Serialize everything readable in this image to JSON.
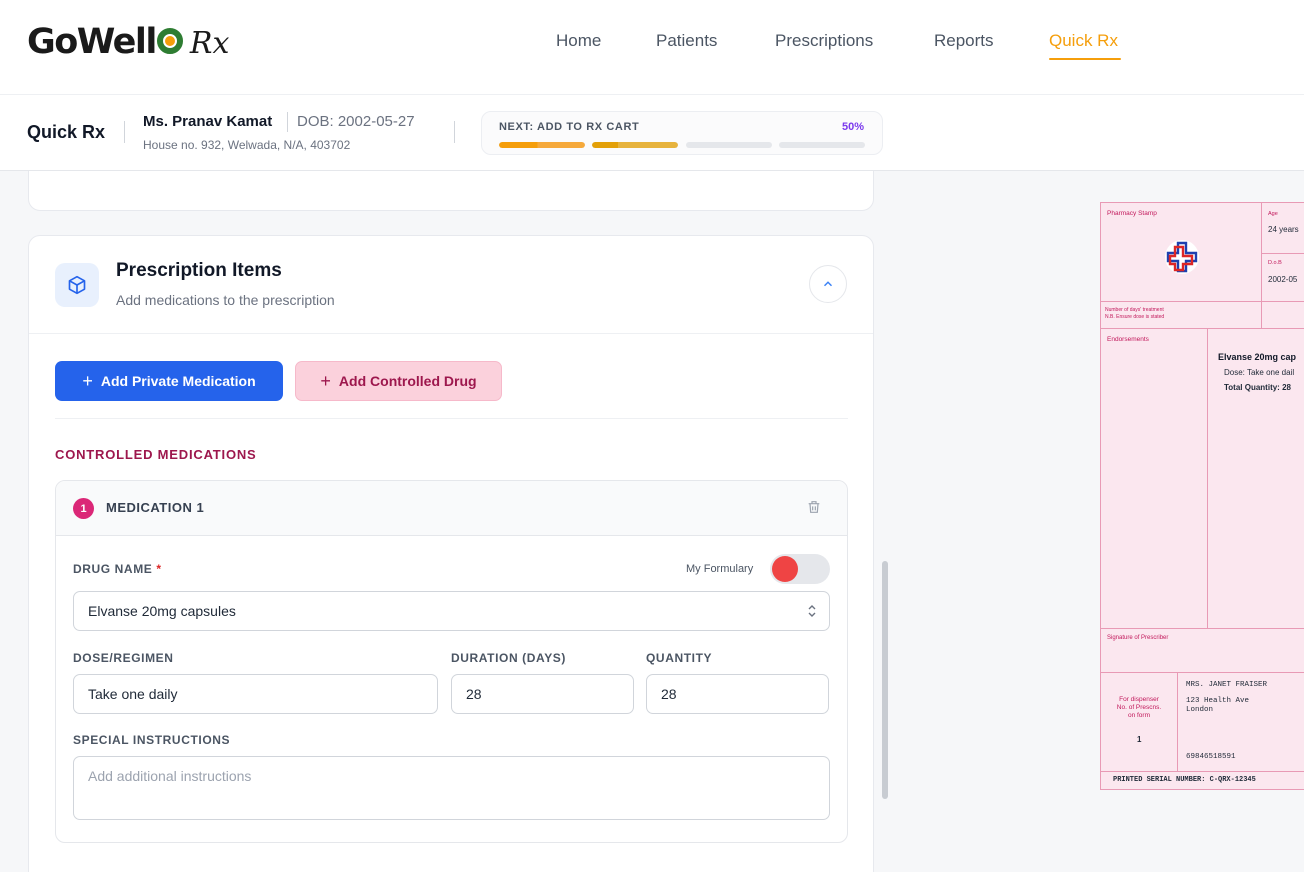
{
  "brand": {
    "logo_main": "GoWell",
    "logo_o": "o",
    "logo_rx": "Rx"
  },
  "nav": {
    "items": [
      {
        "label": "Home"
      },
      {
        "label": "Patients"
      },
      {
        "label": "Prescriptions"
      },
      {
        "label": "Reports"
      },
      {
        "label": "Quick Rx"
      }
    ],
    "active": "Quick Rx",
    "active_color": "#f59e0b"
  },
  "subheader": {
    "title": "Quick Rx",
    "patient_name": "Ms. Pranav Kamat",
    "dob": "DOB: 2002-05-27",
    "address": "House no. 932, Welwada, N/A, 403702",
    "progress": {
      "label": "NEXT: ADD TO RX CART",
      "percent_text": "50%",
      "percent": 50,
      "segments": 4,
      "completed_segments": 2
    }
  },
  "prescription_items": {
    "title": "Prescription Items",
    "subtitle": "Add medications to the prescription",
    "add_private_label": "Add Private Medication",
    "add_controlled_label": "Add Controlled Drug",
    "controlled_heading": "CONTROLLED MEDICATIONS",
    "medication": {
      "number": "1",
      "title": "MEDICATION 1",
      "drug_name_label": "DRUG NAME",
      "required_mark": "*",
      "formulary_label": "My Formulary",
      "formulary_on": false,
      "drug_name_value": "Elvanse 20mg capsules",
      "dose_label": "DOSE/REGIMEN",
      "dose_value": "Take one daily",
      "duration_label": "DURATION (DAYS)",
      "duration_value": "28",
      "quantity_label": "QUANTITY",
      "quantity_value": "28",
      "instructions_label": "SPECIAL INSTRUCTIONS",
      "instructions_placeholder": "Add additional instructions"
    }
  },
  "rx_preview": {
    "pharmacy_stamp": "Pharmacy Stamp",
    "age_label": "Age",
    "age_value": "24 years",
    "dob_label": "D.o.B",
    "dob_value": "2002-05",
    "days_treatment": "Number of days' treatment",
    "ensure_dose": "N.B. Ensure dose is stated",
    "endorsements": "Endorsements",
    "drug": "Elvanse 20mg cap",
    "dose": "Dose: Take one dail",
    "total_quantity": "Total Quantity: 28",
    "signature": "Signature of Prescriber",
    "for_dispenser": "For dispenser No. of Prescns. on form",
    "prescns_count": "1",
    "recipient_name": "MRS. JANET FRAISER",
    "recipient_addr1": "123 Health Ave",
    "recipient_addr2": "London",
    "recipient_id": "69846518591",
    "serial": "PRINTED SERIAL NUMBER: C-QRX-12345"
  },
  "colors": {
    "primary": "#2563eb",
    "controlled_bg": "#fbd1dc",
    "controlled_text": "#9d174d",
    "badge": "#db2777",
    "toggle_knob": "#ef4444",
    "progress_pct": "#7c3aed",
    "progress_fill": "#f59e0b"
  }
}
